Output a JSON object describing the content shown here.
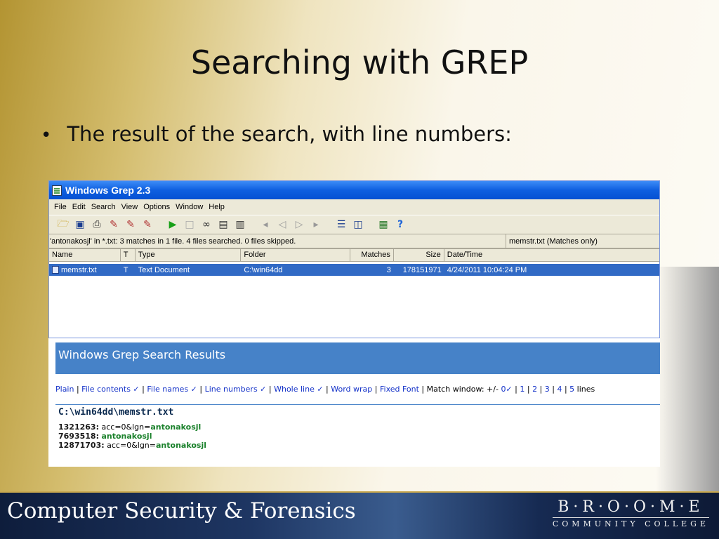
{
  "slide": {
    "title": "Searching with GREP",
    "bullet": "The result of the search, with line numbers:"
  },
  "window": {
    "title": "Windows Grep 2.3",
    "menu": [
      "File",
      "Edit",
      "Search",
      "View",
      "Options",
      "Window",
      "Help"
    ],
    "toolbar_icons": [
      "open-folder-icon",
      "save-icon",
      "print-icon",
      "search-icon",
      "replace-icon",
      "search-more-icon",
      "play-icon",
      "stop-icon",
      "glasses-icon",
      "document-icon",
      "document-lines-icon",
      "first-icon",
      "prev-icon",
      "next-icon",
      "last-icon",
      "split-horizontal-icon",
      "split-vertical-icon",
      "copy-icon",
      "help-icon"
    ],
    "status_left": "'antonakosjl' in *.txt: 3 matches in 1 file. 4 files searched. 0 files skipped.",
    "status_right": "memstr.txt (Matches only)",
    "columns": [
      "Name",
      "T",
      "Type",
      "Folder",
      "Matches",
      "Size",
      "Date/Time"
    ],
    "rows": [
      {
        "name": "memstr.txt",
        "t": "T",
        "type": "Text Document",
        "folder": "C:\\win64dd",
        "matches": "3",
        "size": "178151971",
        "date": "4/24/2011 10:04:24 PM"
      }
    ]
  },
  "results": {
    "header": "Windows Grep Search Results",
    "options": {
      "plain": "Plain",
      "file_contents": "File contents ✓",
      "file_names": "File names ✓",
      "line_numbers": "Line numbers ✓",
      "whole_line": "Whole line ✓",
      "word_wrap": "Word wrap",
      "fixed_font": "Fixed Font",
      "match_window": "Match window: +/-",
      "mw_0": "0✓",
      "mw_1": "1",
      "mw_2": "2",
      "mw_3": "3",
      "mw_4": "4",
      "mw_5": "5",
      "lines": "lines"
    },
    "file_path": "C:\\win64dd\\memstr.txt",
    "lines": [
      {
        "num": "1321263:",
        "pre": "acc=0&lgn=",
        "hit": "antonakosjl"
      },
      {
        "num": "7693518:",
        "pre": "",
        "hit": "antonakosjl"
      },
      {
        "num": "12871703:",
        "pre": "acc=0&lgn=",
        "hit": "antonakosjl"
      }
    ]
  },
  "footer": {
    "title": "Computer Security & Forensics",
    "logo_main": "B·R·O·O·M·E",
    "logo_sub": "COMMUNITY COLLEGE"
  }
}
